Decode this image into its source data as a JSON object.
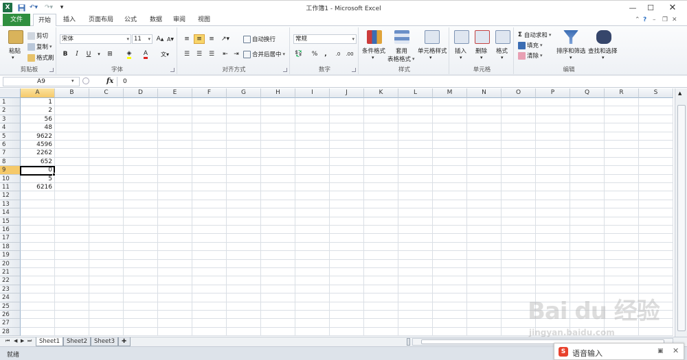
{
  "window": {
    "title": "工作簿1 - Microsoft Excel",
    "app_icon": "X",
    "minimize": "—",
    "maximize": "☐",
    "close": "✕"
  },
  "tabs": {
    "file": "文件",
    "home": "开始",
    "insert": "插入",
    "layout": "页面布局",
    "formula": "公式",
    "data": "数据",
    "review": "审阅",
    "view": "视图"
  },
  "ribbon": {
    "clipboard": {
      "label": "剪贴板",
      "paste": "粘贴",
      "cut": "剪切",
      "copy": "复制",
      "format_painter": "格式刷"
    },
    "font": {
      "label": "字体",
      "font_name": "宋体",
      "font_size": "11",
      "bold": "B",
      "italic": "I",
      "underline": "U"
    },
    "alignment": {
      "label": "对齐方式",
      "wrap_text": "自动换行",
      "merge_center": "合并后居中"
    },
    "number": {
      "label": "数字",
      "format": "常规",
      "percent": "%",
      "comma": ","
    },
    "styles": {
      "label": "样式",
      "conditional": "条件格式",
      "table_format_1": "套用",
      "table_format_2": "表格格式",
      "cell_styles": "单元格样式"
    },
    "cells": {
      "label": "单元格",
      "insert": "插入",
      "delete": "删除",
      "format": "格式"
    },
    "editing": {
      "label": "编辑",
      "autosum": "自动求和",
      "fill": "填充",
      "clear": "清除",
      "sort_filter": "排序和筛选",
      "find_select": "查找和选择"
    }
  },
  "formula_bar": {
    "name_box": "A9",
    "fx": "fx",
    "value": "0"
  },
  "grid": {
    "columns": [
      "A",
      "B",
      "C",
      "D",
      "E",
      "F",
      "G",
      "H",
      "I",
      "J",
      "K",
      "L",
      "M",
      "N",
      "O",
      "P",
      "Q",
      "R",
      "S"
    ],
    "rows": [
      "1",
      "2",
      "3",
      "4",
      "5",
      "6",
      "7",
      "8",
      "9",
      "10",
      "11",
      "12",
      "13",
      "14",
      "15",
      "16",
      "17",
      "18",
      "19",
      "20",
      "21",
      "22",
      "23",
      "24",
      "25",
      "26",
      "27",
      "28"
    ],
    "col_a_values": [
      "1",
      "2",
      "56",
      "48",
      "9622",
      "4596",
      "2262",
      "652",
      "0",
      "5",
      "6216"
    ],
    "selected_column": "A",
    "selected_row": "9"
  },
  "sheets": [
    "Sheet1",
    "Sheet2",
    "Sheet3"
  ],
  "status": {
    "text": "就绪"
  },
  "ime": {
    "label": "语音输入",
    "logo": "S"
  },
  "watermark": {
    "text": "Bai du 经验",
    "url": "jingyan.baidu.com"
  },
  "colors": {
    "accent": "#2f8f3f",
    "selection": "#f5c96a"
  }
}
